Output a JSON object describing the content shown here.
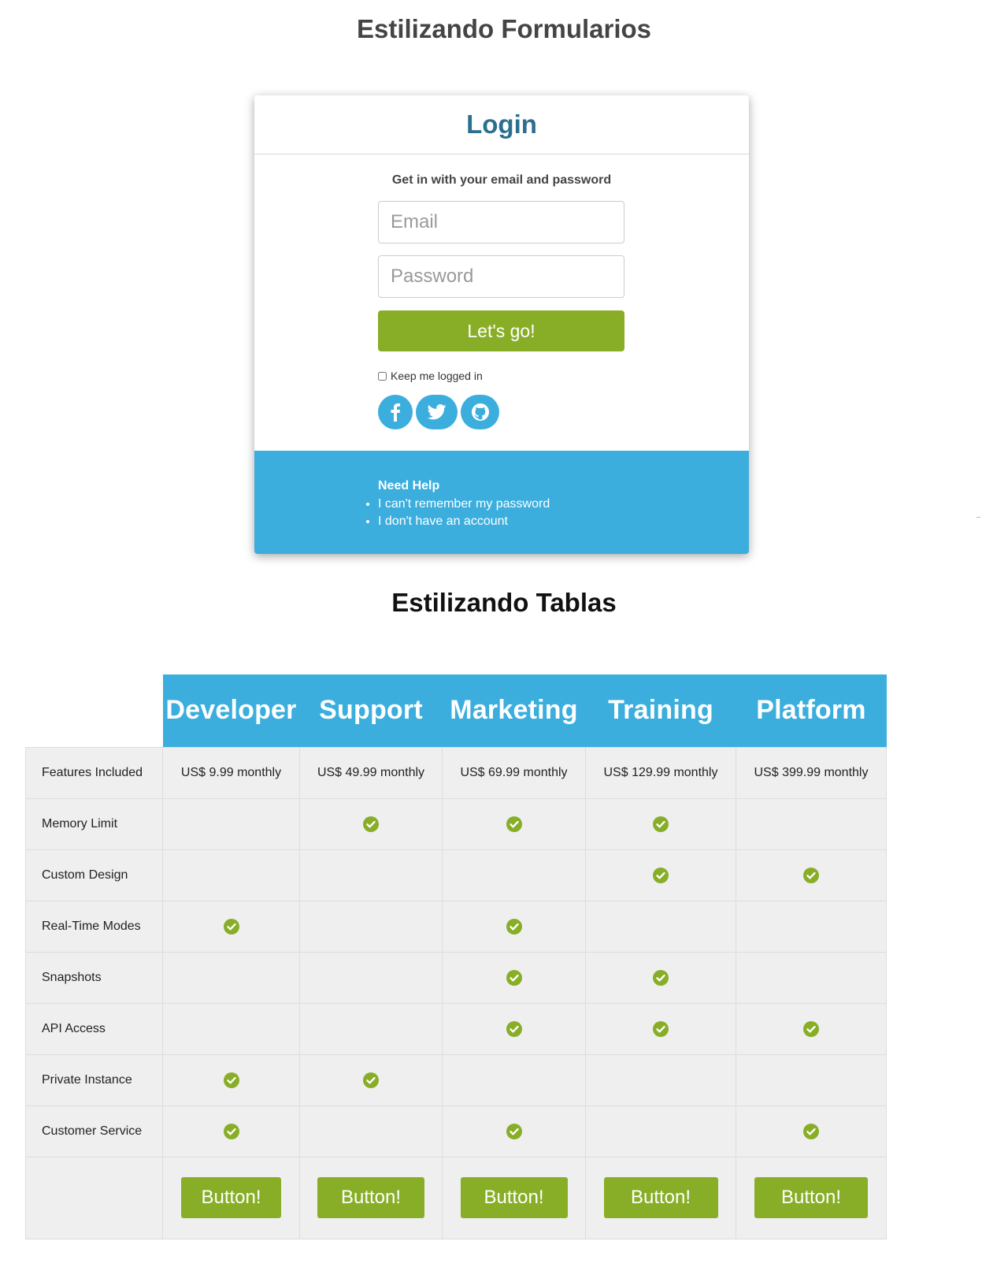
{
  "forms_section": {
    "title": "Estilizando Formularios"
  },
  "login": {
    "title": "Login",
    "subtitle": "Get in with your email and password",
    "email_placeholder": "Email",
    "password_placeholder": "Password",
    "submit_label": "Let's go!",
    "remember_label": "Keep me logged in",
    "socials": [
      "facebook-icon",
      "twitter-icon",
      "github-icon"
    ],
    "help": {
      "title": "Need Help",
      "items": [
        "I can't remember my password",
        "I don't have an account"
      ]
    }
  },
  "tables_section": {
    "title": "Estilizando Tablas"
  },
  "pricing": {
    "plans": [
      "Developer",
      "Support",
      "Marketing",
      "Training",
      "Platform"
    ],
    "features_label": "Features Included",
    "prices": [
      "US$ 9.99 monthly",
      "US$ 49.99 monthly",
      "US$ 69.99 monthly",
      "US$ 129.99 monthly",
      "US$ 399.99 monthly"
    ],
    "features": [
      {
        "name": "Memory Limit",
        "checks": [
          false,
          true,
          true,
          true,
          false
        ]
      },
      {
        "name": "Custom Design",
        "checks": [
          false,
          false,
          false,
          true,
          true
        ]
      },
      {
        "name": "Real-Time Modes",
        "checks": [
          true,
          false,
          true,
          false,
          false
        ]
      },
      {
        "name": "Snapshots",
        "checks": [
          false,
          false,
          true,
          true,
          false
        ]
      },
      {
        "name": "API Access",
        "checks": [
          false,
          false,
          true,
          true,
          true
        ]
      },
      {
        "name": "Private Instance",
        "checks": [
          true,
          true,
          false,
          false,
          false
        ]
      },
      {
        "name": "Customer Service",
        "checks": [
          true,
          false,
          true,
          false,
          true
        ]
      }
    ],
    "button_label": "Button!"
  },
  "colors": {
    "accent_blue": "#3baede",
    "accent_green": "#88ae27",
    "login_title": "#2b6f8f",
    "table_cell": "#efefef"
  }
}
